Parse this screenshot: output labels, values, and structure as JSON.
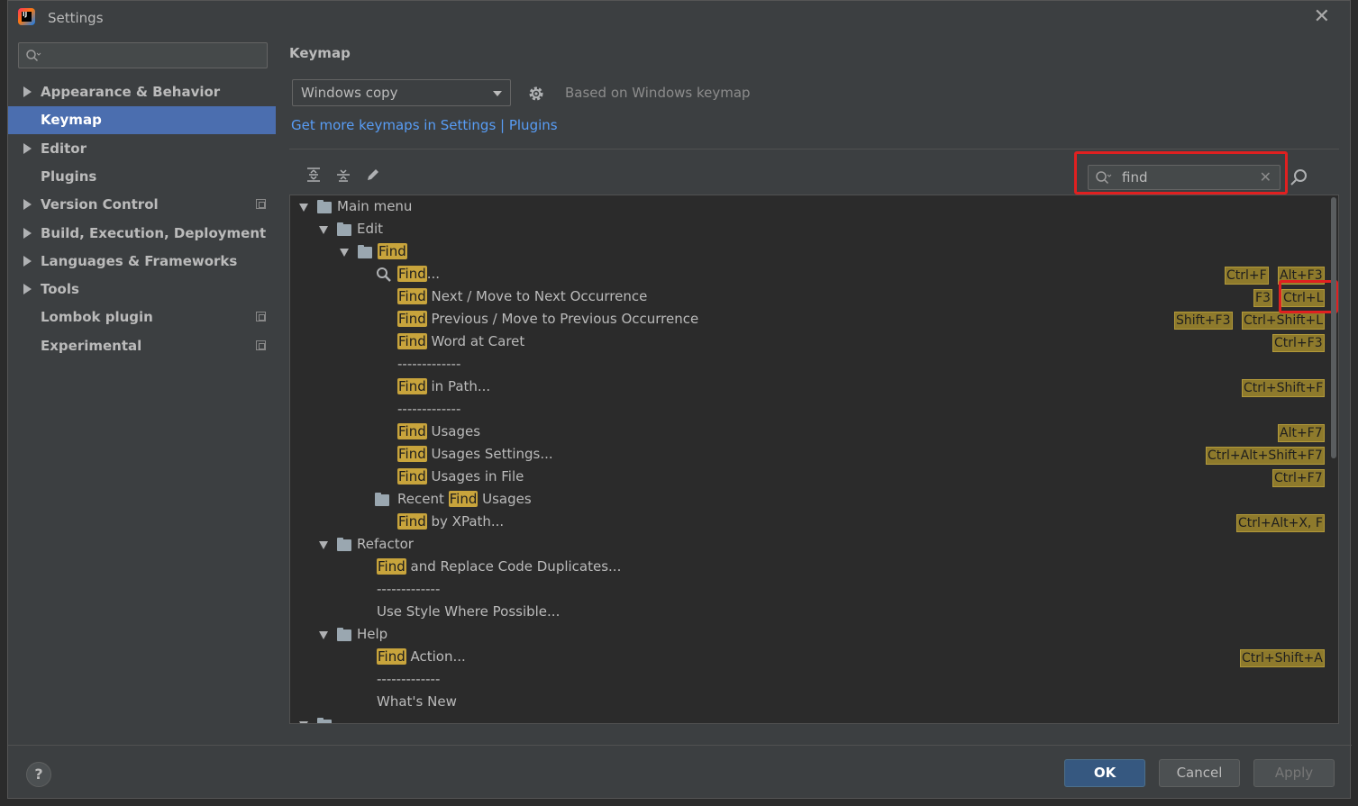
{
  "window": {
    "title": "Settings",
    "close": "✕"
  },
  "sidebar": {
    "search_value": "",
    "items": [
      {
        "label": "Appearance & Behavior",
        "expandable": true,
        "selected": false,
        "copy": false
      },
      {
        "label": "Keymap",
        "expandable": false,
        "selected": true,
        "copy": false
      },
      {
        "label": "Editor",
        "expandable": true,
        "selected": false,
        "copy": false
      },
      {
        "label": "Plugins",
        "expandable": false,
        "selected": false,
        "copy": false
      },
      {
        "label": "Version Control",
        "expandable": true,
        "selected": false,
        "copy": true
      },
      {
        "label": "Build, Execution, Deployment",
        "expandable": true,
        "selected": false,
        "copy": false
      },
      {
        "label": "Languages & Frameworks",
        "expandable": true,
        "selected": false,
        "copy": false
      },
      {
        "label": "Tools",
        "expandable": true,
        "selected": false,
        "copy": false
      },
      {
        "label": "Lombok plugin",
        "expandable": false,
        "selected": false,
        "copy": true
      },
      {
        "label": "Experimental",
        "expandable": false,
        "selected": false,
        "copy": true
      }
    ]
  },
  "keymap": {
    "title": "Keymap",
    "selected_keymap": "Windows copy",
    "based_on": "Based on Windows keymap",
    "links": "Get more keymaps in Settings | Plugins",
    "filter_value": "find"
  },
  "tree": [
    {
      "indent": 0,
      "kind": "group",
      "icon": "main-menu",
      "pre": "",
      "hl": "",
      "post": "Main menu",
      "shortcuts": []
    },
    {
      "indent": 1,
      "kind": "group",
      "icon": "folder",
      "pre": "",
      "hl": "",
      "post": "Edit",
      "shortcuts": []
    },
    {
      "indent": 2,
      "kind": "group",
      "icon": "folder",
      "pre": "",
      "hl": "Find",
      "post": "",
      "shortcuts": []
    },
    {
      "indent": 3,
      "kind": "action",
      "icon": "search",
      "pre": "",
      "hl": "Find",
      "post": "...",
      "shortcuts": [
        "Ctrl+F",
        "Alt+F3"
      ]
    },
    {
      "indent": 3,
      "kind": "action",
      "icon": "",
      "pre": "",
      "hl": "Find",
      "post": " Next / Move to Next Occurrence",
      "shortcuts": [
        "F3",
        "Ctrl+L"
      ]
    },
    {
      "indent": 3,
      "kind": "action",
      "icon": "",
      "pre": "",
      "hl": "Find",
      "post": " Previous / Move to Previous Occurrence",
      "shortcuts": [
        "Shift+F3",
        "Ctrl+Shift+L"
      ]
    },
    {
      "indent": 3,
      "kind": "action",
      "icon": "",
      "pre": "",
      "hl": "Find",
      "post": " Word at Caret",
      "shortcuts": [
        "Ctrl+F3"
      ]
    },
    {
      "indent": 3,
      "kind": "sep",
      "icon": "",
      "pre": "",
      "hl": "",
      "post": "-------------",
      "shortcuts": []
    },
    {
      "indent": 3,
      "kind": "action",
      "icon": "",
      "pre": "",
      "hl": "Find",
      "post": " in Path...",
      "shortcuts": [
        "Ctrl+Shift+F"
      ]
    },
    {
      "indent": 3,
      "kind": "sep",
      "icon": "",
      "pre": "",
      "hl": "",
      "post": "-------------",
      "shortcuts": []
    },
    {
      "indent": 3,
      "kind": "action",
      "icon": "",
      "pre": "",
      "hl": "Find",
      "post": " Usages",
      "shortcuts": [
        "Alt+F7"
      ]
    },
    {
      "indent": 3,
      "kind": "action",
      "icon": "",
      "pre": "",
      "hl": "Find",
      "post": " Usages Settings...",
      "shortcuts": [
        "Ctrl+Alt+Shift+F7"
      ]
    },
    {
      "indent": 3,
      "kind": "action",
      "icon": "",
      "pre": "",
      "hl": "Find",
      "post": " Usages in File",
      "shortcuts": [
        "Ctrl+F7"
      ]
    },
    {
      "indent": 3,
      "kind": "group-leaf",
      "icon": "folder",
      "pre": "Recent ",
      "hl": "Find",
      "post": " Usages",
      "shortcuts": []
    },
    {
      "indent": 3,
      "kind": "action",
      "icon": "",
      "pre": "",
      "hl": "Find",
      "post": " by XPath...",
      "shortcuts": [
        "Ctrl+Alt+X, F"
      ]
    },
    {
      "indent": 1,
      "kind": "group",
      "icon": "folder",
      "pre": "",
      "hl": "",
      "post": "Refactor",
      "shortcuts": []
    },
    {
      "indent": 2,
      "kind": "action",
      "icon": "",
      "pre": "",
      "hl": "Find",
      "post": " and Replace Code Duplicates...",
      "shortcuts": []
    },
    {
      "indent": 2,
      "kind": "sep",
      "icon": "",
      "pre": "",
      "hl": "",
      "post": "-------------",
      "shortcuts": []
    },
    {
      "indent": 2,
      "kind": "action",
      "icon": "",
      "pre": "",
      "hl": "",
      "post": "Use Style Where Possible...",
      "shortcuts": []
    },
    {
      "indent": 1,
      "kind": "group",
      "icon": "folder",
      "pre": "",
      "hl": "",
      "post": "Help",
      "shortcuts": []
    },
    {
      "indent": 2,
      "kind": "action",
      "icon": "",
      "pre": "",
      "hl": "Find",
      "post": " Action...",
      "shortcuts": [
        "Ctrl+Shift+A"
      ]
    },
    {
      "indent": 2,
      "kind": "sep",
      "icon": "",
      "pre": "",
      "hl": "",
      "post": "-------------",
      "shortcuts": []
    },
    {
      "indent": 2,
      "kind": "action",
      "icon": "",
      "pre": "",
      "hl": "",
      "post": "What's New",
      "shortcuts": []
    },
    {
      "indent": 0,
      "kind": "group",
      "icon": "folder",
      "pre": "",
      "hl": "",
      "post": "",
      "shortcuts": []
    }
  ],
  "buttons": {
    "help": "?",
    "ok": "OK",
    "cancel": "Cancel",
    "apply": "Apply"
  },
  "colors": {
    "selection": "#4b6eaf",
    "highlight": "#c8a43c",
    "link": "#589df6",
    "annotation": "#e02020"
  }
}
